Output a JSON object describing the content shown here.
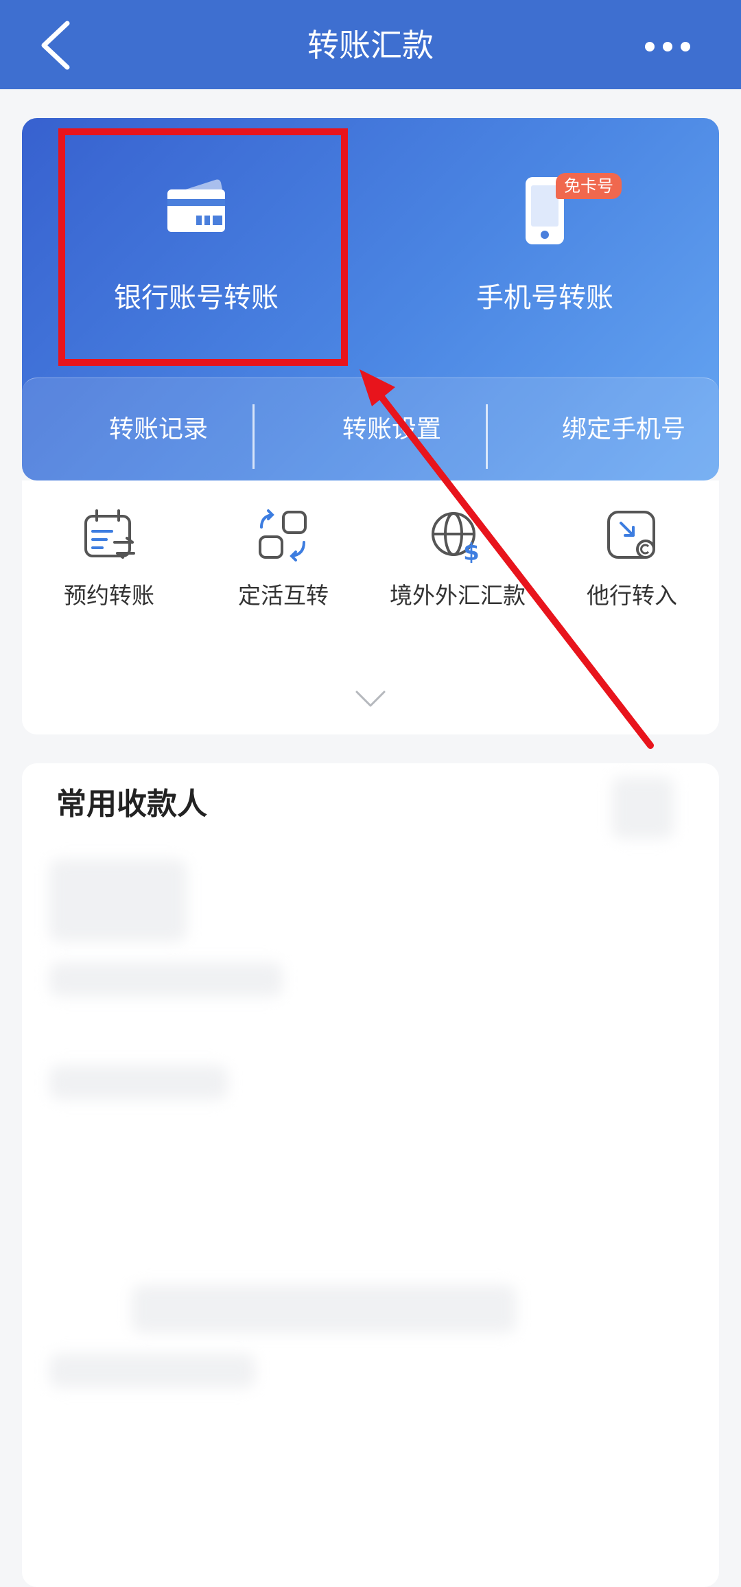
{
  "header": {
    "title": "转账汇款"
  },
  "hero": {
    "bank_transfer_label": "银行账号转账",
    "phone_transfer_label": "手机号转账",
    "phone_badge": "免卡号"
  },
  "hero_bar": {
    "items": [
      {
        "label": "转账记录"
      },
      {
        "label": "转账设置"
      },
      {
        "label": "绑定手机号"
      }
    ]
  },
  "quick_actions": {
    "items": [
      {
        "label": "预约转账",
        "icon": "calendar-transfer-icon"
      },
      {
        "label": "定活互转",
        "icon": "exchange-squares-icon"
      },
      {
        "label": "境外外汇汇款",
        "icon": "globe-dollar-icon"
      },
      {
        "label": "他行转入",
        "icon": "incoming-transfer-icon"
      }
    ]
  },
  "payees": {
    "title": "常用收款人"
  },
  "colors": {
    "header_bg": "#3e6fd0",
    "hero_gradient_start": "#3761cf",
    "hero_gradient_end": "#66a6f2",
    "badge_bg": "#f0684e",
    "highlight_red": "#e8141c"
  }
}
